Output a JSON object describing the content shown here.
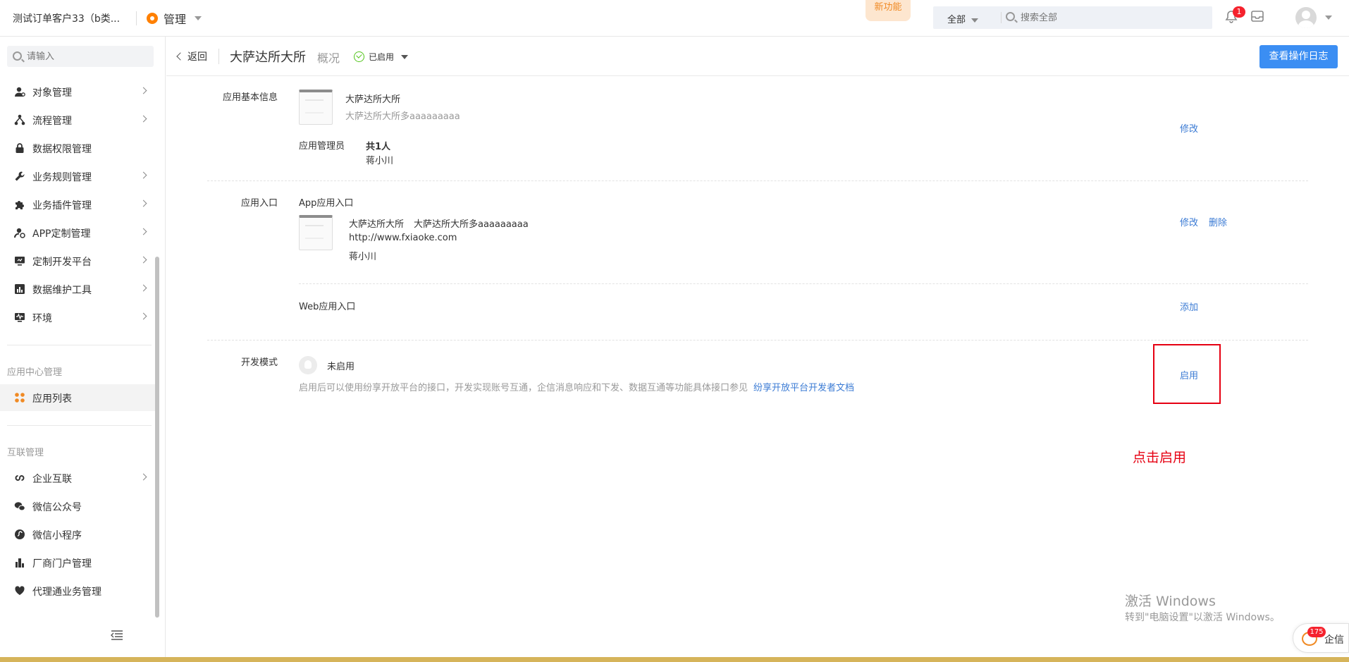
{
  "topbar": {
    "tenant": "测试订单客户33（b类...",
    "module": "管理",
    "new_feature": "新功能",
    "search_scope": "全部",
    "search_placeholder": "搜索全部",
    "notification_count": "1"
  },
  "sidebar": {
    "search_placeholder": "请输入",
    "items": [
      {
        "label": "对象管理",
        "icon": "user-cog-icon"
      },
      {
        "label": "流程管理",
        "icon": "flow-icon"
      },
      {
        "label": "数据权限管理",
        "icon": "lock-icon"
      },
      {
        "label": "业务规则管理",
        "icon": "wrench-icon"
      },
      {
        "label": "业务插件管理",
        "icon": "puzzle-icon"
      },
      {
        "label": "APP定制管理",
        "icon": "app-custom-icon"
      },
      {
        "label": "定制开发平台",
        "icon": "monitor-icon"
      },
      {
        "label": "数据维护工具",
        "icon": "bar-chart-icon"
      },
      {
        "label": "环境",
        "icon": "pulse-icon"
      }
    ],
    "section_app": "应用中心管理",
    "app_list": "应用列表",
    "section_interconnect": "互联管理",
    "interconnect_items": [
      {
        "label": "企业互联",
        "icon": "link-icon"
      },
      {
        "label": "微信公众号",
        "icon": "wechat-icon"
      },
      {
        "label": "微信小程序",
        "icon": "miniprogram-icon"
      },
      {
        "label": "厂商门户管理",
        "icon": "building-icon"
      },
      {
        "label": "代理通业务管理",
        "icon": "heart-handshake-icon"
      }
    ]
  },
  "header": {
    "back": "返回",
    "app_name": "大萨达所大所",
    "overview": "概况",
    "status": "已启用",
    "log_button": "查看操作日志"
  },
  "basic_info": {
    "label": "应用基本信息",
    "name": "大萨达所大所",
    "description": "大萨达所大所多aaaaaaaaa",
    "admin_label": "应用管理员",
    "admin_count": "共1人",
    "admin_name": "蒋小川",
    "edit": "修改"
  },
  "entry": {
    "label": "应用入口",
    "app_entry_title": "App应用入口",
    "app_entry_name": "大萨达所大所",
    "app_entry_desc": "大萨达所大所多aaaaaaaaa",
    "app_entry_url": "http://www.fxiaoke.com",
    "app_entry_owner": "蒋小川",
    "edit": "修改",
    "delete": "删除",
    "web_entry_title": "Web应用入口",
    "add": "添加"
  },
  "dev_mode": {
    "label": "开发模式",
    "status": "未启用",
    "description": "启用后可以使用纷享开放平台的接口，开发实现账号互通，企信消息响应和下发、数据互通等功能具体接口参见",
    "doc_link": "纷享开放平台开发者文档",
    "enable": "启用"
  },
  "annotation": "点击启用",
  "watermark": {
    "line1": "激活 Windows",
    "line2": "转到\"电脑设置\"以激活 Windows。"
  },
  "qixin": {
    "badge": "175",
    "label": "企信"
  },
  "colors": {
    "accent": "#3b8ef3",
    "link": "#3b7bd4",
    "annotation_red": "#e60012",
    "brand_orange": "#ff8000"
  }
}
